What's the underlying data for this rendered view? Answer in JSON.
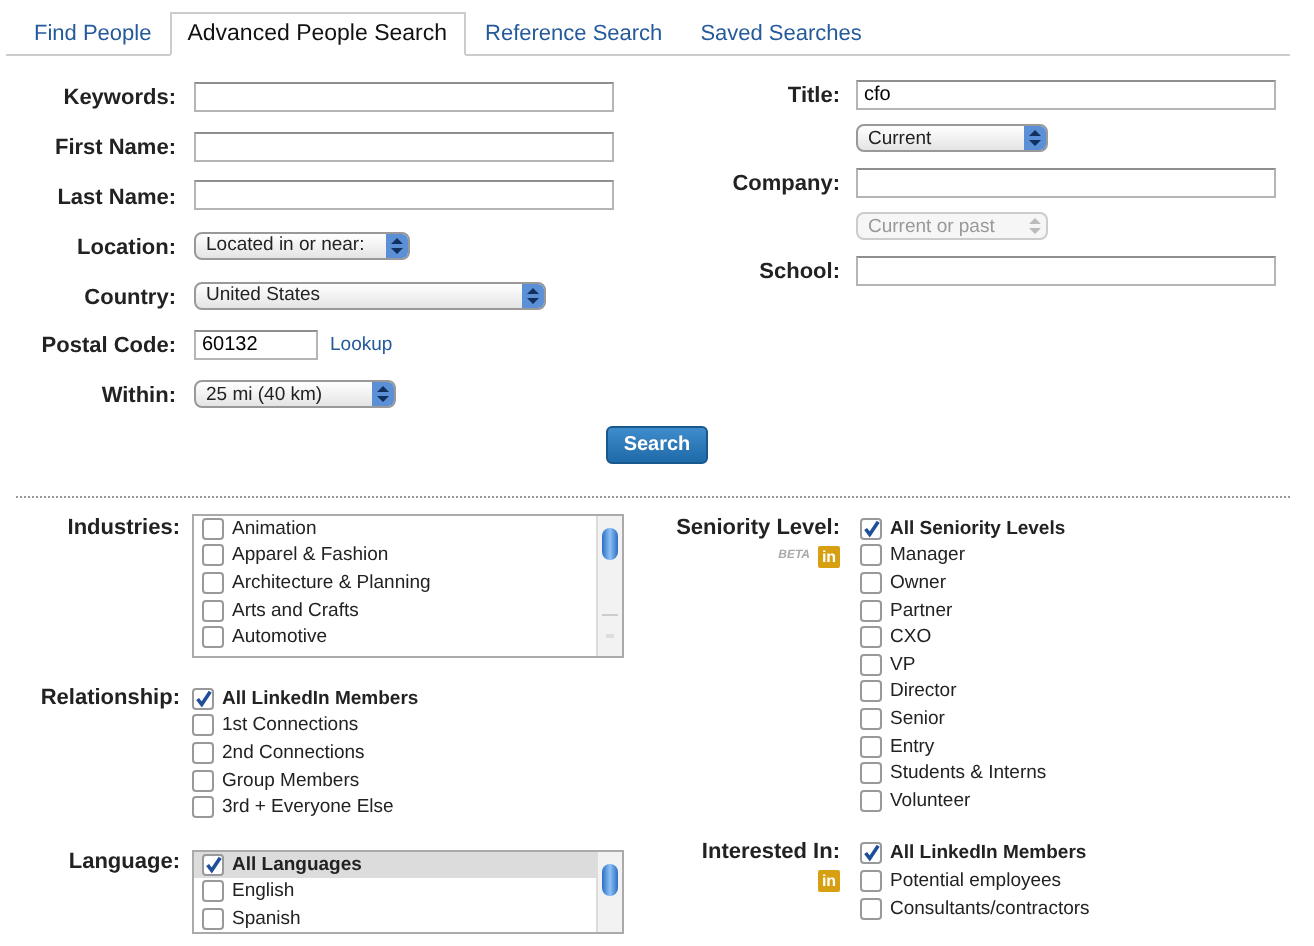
{
  "tabs": [
    {
      "label": "Find People",
      "selected": false
    },
    {
      "label": "Advanced People Search",
      "selected": true
    },
    {
      "label": "Reference Search",
      "selected": false
    },
    {
      "label": "Saved Searches",
      "selected": false
    }
  ],
  "form_left": [
    {
      "kind": "text",
      "label": "Keywords:"
    },
    {
      "kind": "text",
      "label": "First Name:"
    },
    {
      "kind": "text",
      "label": "Last Name:"
    },
    {
      "kind": "select",
      "label": "Location:",
      "value": "Located in or near:",
      "disabled": false
    },
    {
      "kind": "select",
      "label": "Country:",
      "value": "United States",
      "disabled": false
    },
    {
      "kind": "postal",
      "label": "Postal Code:",
      "value": "60132",
      "link": "Lookup"
    },
    {
      "kind": "select",
      "label": "Within:",
      "value": "25 mi (40 km)",
      "disabled": false
    }
  ],
  "form_right": [
    {
      "kind": "text",
      "label": "Title:",
      "value": "cfo"
    },
    {
      "kind": "select",
      "value": "Current",
      "disabled": false
    },
    {
      "kind": "text",
      "label": "Company:"
    },
    {
      "kind": "select",
      "value": "Current or past",
      "disabled": true
    },
    {
      "kind": "text",
      "label": "School:"
    }
  ],
  "search_button": "Search",
  "filters_left": [
    {
      "kind": "scroll_list",
      "label": "Industries:",
      "items": [
        {
          "label": "Animation",
          "checked": false
        },
        {
          "label": "Apparel & Fashion",
          "checked": false
        },
        {
          "label": "Architecture & Planning",
          "checked": false
        },
        {
          "label": "Arts and Crafts",
          "checked": false
        },
        {
          "label": "Automotive",
          "checked": false
        }
      ]
    },
    {
      "kind": "checks",
      "label": "Relationship:",
      "items": [
        {
          "label": "All LinkedIn Members",
          "checked": true
        },
        {
          "label": "1st Connections",
          "checked": false
        },
        {
          "label": "2nd Connections",
          "checked": false
        },
        {
          "label": "Group Members",
          "checked": false
        },
        {
          "label": "3rd + Everyone Else",
          "checked": false
        }
      ]
    },
    {
      "kind": "scroll_list",
      "label": "Language:",
      "items": [
        {
          "label": "All Languages",
          "checked": true,
          "selected": true
        },
        {
          "label": "English",
          "checked": false,
          "selected": false
        },
        {
          "label": "Spanish",
          "checked": false,
          "selected": false
        }
      ]
    }
  ],
  "filters_right": [
    {
      "kind": "checks",
      "label": "Seniority Level:",
      "beta": "BETA",
      "logo": "in",
      "items": [
        {
          "label": "All Seniority Levels",
          "checked": true
        },
        {
          "label": "Manager",
          "checked": false
        },
        {
          "label": "Owner",
          "checked": false
        },
        {
          "label": "Partner",
          "checked": false
        },
        {
          "label": "CXO",
          "checked": false
        },
        {
          "label": "VP",
          "checked": false
        },
        {
          "label": "Director",
          "checked": false
        },
        {
          "label": "Senior",
          "checked": false
        },
        {
          "label": "Entry",
          "checked": false
        },
        {
          "label": "Students & Interns",
          "checked": false
        },
        {
          "label": "Volunteer",
          "checked": false
        }
      ]
    },
    {
      "kind": "checks",
      "label": "Interested In:",
      "logo": "in",
      "items": [
        {
          "label": "All LinkedIn Members",
          "checked": true
        },
        {
          "label": "Potential employees",
          "checked": false
        },
        {
          "label": "Consultants/contractors",
          "checked": false
        }
      ]
    }
  ]
}
